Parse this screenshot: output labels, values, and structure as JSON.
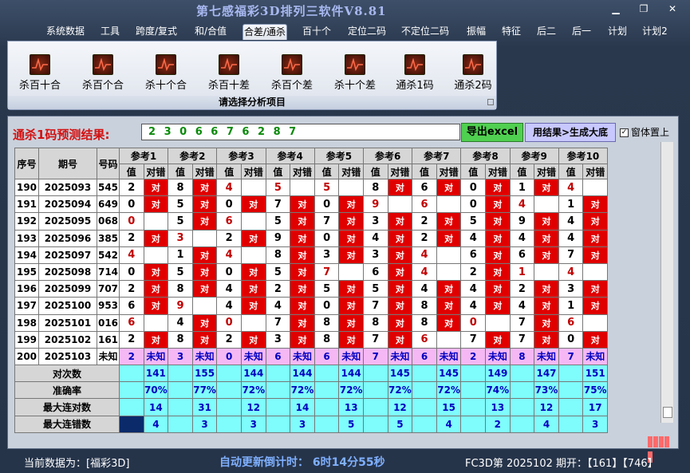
{
  "app": {
    "title": "第七感福彩3D排列三软件V8.81"
  },
  "menu": [
    "系统数据",
    "工具",
    "跨度/复式",
    "和/合值",
    "合差/通杀",
    "百十个",
    "定位二码",
    "不定位二码",
    "振幅",
    "特征",
    "后二",
    "后一",
    "计划",
    "计划2"
  ],
  "ribbon": {
    "buttons": [
      "杀百十合",
      "杀百个合",
      "杀十个合",
      "杀百十差",
      "杀百个差",
      "杀十个差",
      "通杀1码",
      "通杀2码"
    ],
    "caption": "请选择分析项目"
  },
  "prediction": {
    "label": "通杀1码预测结果:",
    "value": "2 3 0 6 6 7 6 2 8 7"
  },
  "buttons": {
    "excel": "导出excel",
    "generate": "用结果>生成大底",
    "topmost": "窗体置上"
  },
  "table": {
    "headers": {
      "seq": "序号",
      "issue": "期号",
      "code": "号码",
      "refs": [
        "参考1",
        "参考2",
        "参考3",
        "参考4",
        "参考5",
        "参考6",
        "参考7",
        "参考8",
        "参考9",
        "参考10"
      ],
      "val": "值",
      "hit": "对错"
    },
    "hit_text": "对",
    "rows": [
      {
        "seq": "190",
        "issue": "2025093",
        "code": "545",
        "v": [
          "2",
          "8",
          "4",
          "",
          "5",
          "",
          "5",
          "",
          "8",
          "6",
          "0",
          "1",
          "4"
        ]
      },
      {
        "seq": "191",
        "issue": "2025094",
        "code": "649",
        "v": []
      },
      {
        "seq": "192",
        "issue": "2025095",
        "code": "068",
        "v": []
      },
      {
        "seq": "193",
        "issue": "2025096",
        "code": "385",
        "v": []
      },
      {
        "seq": "194",
        "issue": "2025097",
        "code": "542",
        "v": []
      },
      {
        "seq": "195",
        "issue": "2025098",
        "code": "714",
        "v": []
      },
      {
        "seq": "196",
        "issue": "2025099",
        "code": "707",
        "v": []
      },
      {
        "seq": "197",
        "issue": "2025100",
        "code": "953",
        "v": []
      },
      {
        "seq": "198",
        "issue": "2025101",
        "code": "016",
        "v": []
      },
      {
        "seq": "199",
        "issue": "2025102",
        "code": "161",
        "v": []
      }
    ],
    "cells": [
      [
        [
          "2",
          1,
          0
        ],
        [
          "8",
          1,
          0
        ],
        [
          "4",
          0,
          1
        ],
        [
          "5",
          0,
          1
        ],
        [
          "5",
          0,
          1
        ],
        [
          "8",
          1,
          0
        ],
        [
          "6",
          1,
          0
        ],
        [
          "0",
          1,
          0
        ],
        [
          "1",
          1,
          0
        ],
        [
          "4",
          0,
          1
        ]
      ],
      [
        [
          "0",
          1,
          0
        ],
        [
          "5",
          1,
          0
        ],
        [
          "0",
          1,
          0
        ],
        [
          "7",
          1,
          0
        ],
        [
          "0",
          1,
          0
        ],
        [
          "9",
          0,
          1
        ],
        [
          "6",
          0,
          1
        ],
        [
          "0",
          1,
          0
        ],
        [
          "4",
          0,
          1
        ],
        [
          "1",
          1,
          0
        ]
      ],
      [
        [
          "0",
          0,
          1
        ],
        [
          "5",
          1,
          0
        ],
        [
          "6",
          0,
          1
        ],
        [
          "5",
          1,
          0
        ],
        [
          "7",
          1,
          0
        ],
        [
          "3",
          1,
          0
        ],
        [
          "2",
          1,
          0
        ],
        [
          "5",
          1,
          0
        ],
        [
          "9",
          1,
          0
        ],
        [
          "4",
          1,
          0
        ]
      ],
      [
        [
          "2",
          1,
          0
        ],
        [
          "3",
          0,
          1
        ],
        [
          "2",
          1,
          0
        ],
        [
          "9",
          1,
          0
        ],
        [
          "0",
          1,
          0
        ],
        [
          "4",
          1,
          0
        ],
        [
          "2",
          1,
          0
        ],
        [
          "4",
          1,
          0
        ],
        [
          "4",
          1,
          0
        ],
        [
          "4",
          1,
          0
        ]
      ],
      [
        [
          "4",
          0,
          1
        ],
        [
          "1",
          1,
          0
        ],
        [
          "4",
          0,
          1
        ],
        [
          "8",
          1,
          0
        ],
        [
          "3",
          1,
          0
        ],
        [
          "3",
          1,
          0
        ],
        [
          "4",
          0,
          1
        ],
        [
          "6",
          1,
          0
        ],
        [
          "6",
          1,
          0
        ],
        [
          "7",
          1,
          0
        ]
      ],
      [
        [
          "0",
          1,
          0
        ],
        [
          "5",
          1,
          0
        ],
        [
          "0",
          1,
          0
        ],
        [
          "5",
          1,
          0
        ],
        [
          "7",
          0,
          1
        ],
        [
          "6",
          1,
          0
        ],
        [
          "4",
          0,
          1
        ],
        [
          "2",
          1,
          0
        ],
        [
          "1",
          0,
          1
        ],
        [
          "4",
          0,
          1
        ]
      ],
      [
        [
          "2",
          1,
          0
        ],
        [
          "8",
          1,
          0
        ],
        [
          "4",
          1,
          0
        ],
        [
          "2",
          1,
          0
        ],
        [
          "5",
          1,
          0
        ],
        [
          "5",
          1,
          0
        ],
        [
          "4",
          1,
          0
        ],
        [
          "4",
          1,
          0
        ],
        [
          "2",
          1,
          0
        ],
        [
          "3",
          1,
          0
        ]
      ],
      [
        [
          "6",
          1,
          0
        ],
        [
          "9",
          0,
          1
        ],
        [
          "4",
          1,
          0
        ],
        [
          "4",
          1,
          0
        ],
        [
          "0",
          1,
          0
        ],
        [
          "7",
          1,
          0
        ],
        [
          "8",
          1,
          0
        ],
        [
          "4",
          1,
          0
        ],
        [
          "4",
          1,
          0
        ],
        [
          "1",
          1,
          0
        ]
      ],
      [
        [
          "6",
          0,
          1
        ],
        [
          "4",
          1,
          0
        ],
        [
          "0",
          0,
          1
        ],
        [
          "7",
          1,
          0
        ],
        [
          "8",
          1,
          0
        ],
        [
          "8",
          1,
          0
        ],
        [
          "8",
          1,
          0
        ],
        [
          "0",
          0,
          1
        ],
        [
          "7",
          1,
          0
        ],
        [
          "6",
          0,
          1
        ]
      ],
      [
        [
          "2",
          1,
          0
        ],
        [
          "8",
          1,
          0
        ],
        [
          "2",
          1,
          0
        ],
        [
          "3",
          1,
          0
        ],
        [
          "8",
          1,
          0
        ],
        [
          "7",
          1,
          0
        ],
        [
          "6",
          0,
          1
        ],
        [
          "7",
          1,
          0
        ],
        [
          "7",
          1,
          0
        ],
        [
          "0",
          1,
          0
        ]
      ]
    ],
    "next": {
      "seq": "200",
      "issue": "2025103",
      "code": "未知",
      "vals": [
        "2",
        "3",
        "0",
        "6",
        "6",
        "7",
        "6",
        "2",
        "8",
        "7"
      ],
      "status": "未知"
    },
    "stats": [
      {
        "label": "对次数",
        "values": [
          "141",
          "155",
          "144",
          "144",
          "144",
          "145",
          "145",
          "149",
          "147",
          "151"
        ]
      },
      {
        "label": "准确率",
        "values": [
          "70%",
          "77%",
          "72%",
          "72%",
          "72%",
          "72%",
          "72%",
          "74%",
          "73%",
          "75%"
        ]
      },
      {
        "label": "最大连对数",
        "values": [
          "14",
          "31",
          "12",
          "14",
          "13",
          "12",
          "15",
          "13",
          "12",
          "17"
        ]
      },
      {
        "label": "最大连错数",
        "values": [
          "4",
          "3",
          "3",
          "3",
          "5",
          "5",
          "4",
          "2",
          "4",
          "3"
        ]
      }
    ]
  },
  "status": {
    "current": "当前数据为：[福彩3D]",
    "countdown": "自动更新倒计时： 6时14分55秒",
    "issue": "FC3D第 2025102 期开：【161】【746】"
  }
}
